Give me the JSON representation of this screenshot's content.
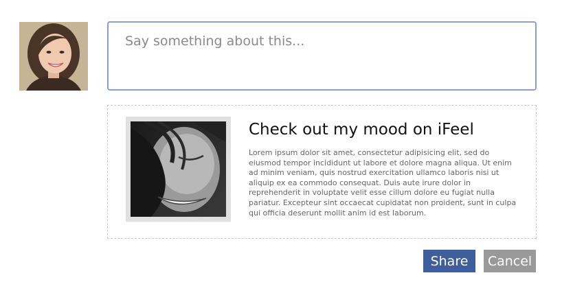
{
  "comment": {
    "placeholder": "Say something about this..."
  },
  "preview": {
    "title": "Check out my mood on iFeel",
    "description": "Lorem ipsum dolor sit amet, consectetur adipisicing elit, sed do eiusmod tempor incididunt ut labore et dolore magna aliqua. Ut enim ad minim veniam, quis nostrud exercitation ullamco laboris nisi ut aliquip ex ea commodo consequat. Duis aute irure dolor in reprehenderit in voluptate velit esse cillum dolore eu fugiat nulla pariatur. Excepteur sint occaecat cupidatat non proident, sunt in culpa qui officia deserunt mollit anim id est laborum."
  },
  "actions": {
    "share_label": "Share",
    "cancel_label": "Cancel"
  },
  "colors": {
    "share_button": "#3f5f9b",
    "cancel_button": "#999999",
    "textarea_border": "#8aa0cc"
  }
}
